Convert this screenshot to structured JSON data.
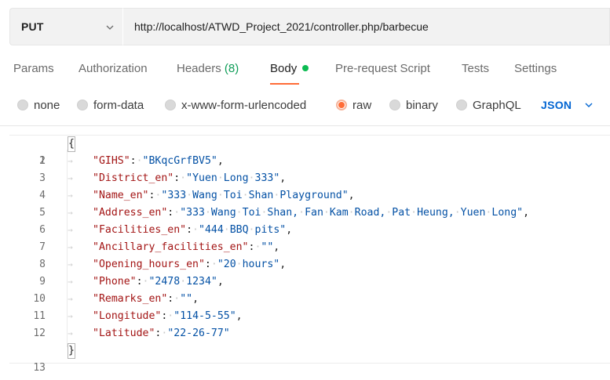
{
  "request": {
    "method": "PUT",
    "url": "http://localhost/ATWD_Project_2021/controller.php/barbecue"
  },
  "tabs": [
    {
      "label": "Params"
    },
    {
      "label": "Authorization"
    },
    {
      "label": "Headers",
      "count": "(8)"
    },
    {
      "label": "Body"
    },
    {
      "label": "Pre-request Script"
    },
    {
      "label": "Tests"
    },
    {
      "label": "Settings"
    }
  ],
  "body_types": [
    {
      "label": "none",
      "selected": false
    },
    {
      "label": "form-data",
      "selected": false
    },
    {
      "label": "x-www-form-urlencoded",
      "selected": false
    },
    {
      "label": "raw",
      "selected": true
    },
    {
      "label": "binary",
      "selected": false
    },
    {
      "label": "GraphQL",
      "selected": false
    }
  ],
  "language": "JSON",
  "colors": {
    "accent": "#ff6c37",
    "active_dot": "#0cbb52",
    "link_blue": "#0265d2",
    "json_key": "#a31515",
    "json_string": "#0451a5"
  },
  "editor": {
    "open_brace": "{",
    "close_brace": "}",
    "line_numbers": [
      "1",
      "2",
      "3",
      "4",
      "5",
      "6",
      "7",
      "8",
      "9",
      "10",
      "11",
      "12",
      "13"
    ],
    "entries": [
      {
        "key": "\"GIHS\"",
        "value": "\"BKqcGrfBV5\""
      },
      {
        "key": "\"District_en\"",
        "value": "\"Yuen Long 333\""
      },
      {
        "key": "\"Name_en\"",
        "value": "\"333 Wang Toi Shan Playground\""
      },
      {
        "key": "\"Address_en\"",
        "value": "\"333 Wang Toi Shan, Fan Kam Road, Pat Heung, Yuen Long\""
      },
      {
        "key": "\"Facilities_en\"",
        "value": "\"444 BBQ pits\""
      },
      {
        "key": "\"Ancillary_facilities_en\"",
        "value": "\"\""
      },
      {
        "key": "\"Opening_hours_en\"",
        "value": "\"20 hours\""
      },
      {
        "key": "\"Phone\"",
        "value": "\"2478 1234\""
      },
      {
        "key": "\"Remarks_en\"",
        "value": "\"\""
      },
      {
        "key": "\"Longitude\"",
        "value": "\"114-5-55\""
      },
      {
        "key": "\"Latitude\"",
        "value": "\"22-26-77\""
      }
    ]
  }
}
